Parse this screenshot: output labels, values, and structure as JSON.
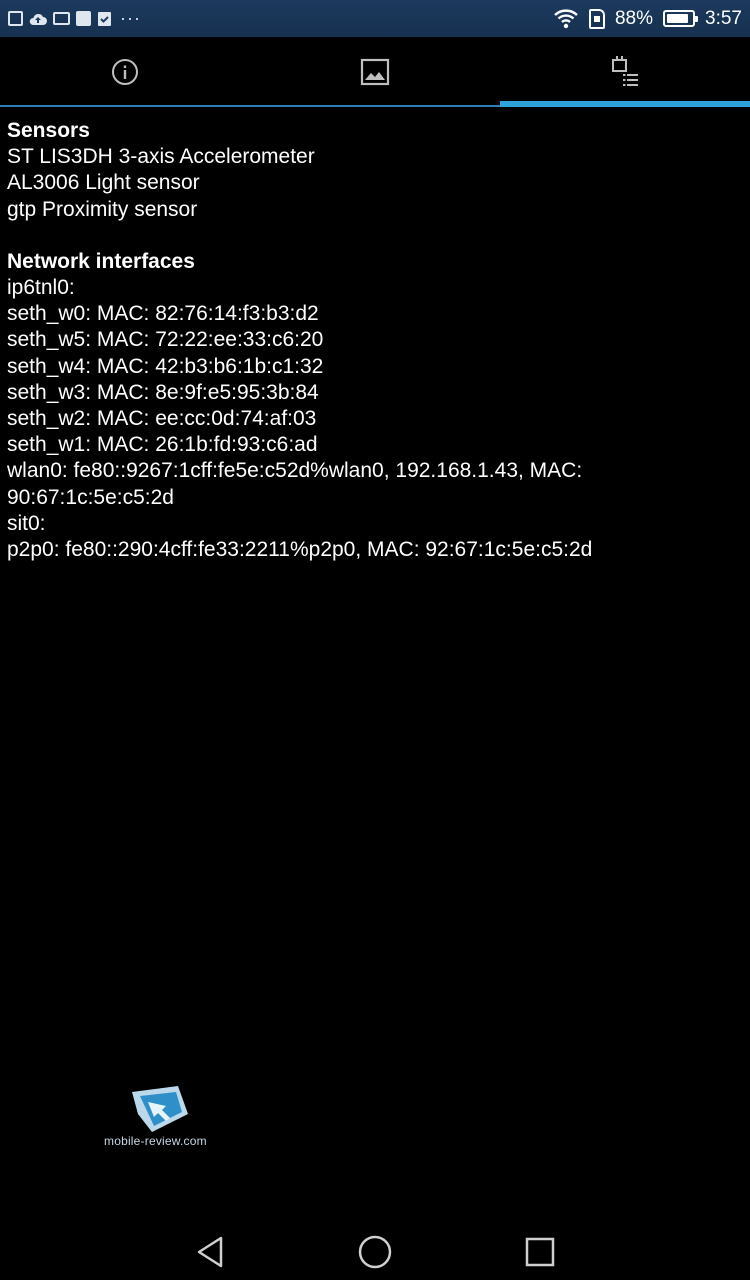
{
  "status_bar": {
    "left_icons": [
      "gallery-icon",
      "cloud-upload-icon",
      "keyboard-icon",
      "google-plus-icon",
      "clipboard-check-icon"
    ],
    "more": "···",
    "battery_percent": "88%",
    "battery_level": 0.88,
    "time": "3:57"
  },
  "tabs": [
    {
      "icon": "info-icon",
      "active": false
    },
    {
      "icon": "image-icon",
      "active": false
    },
    {
      "icon": "device-list-icon",
      "active": true
    }
  ],
  "sensors": {
    "heading": "Sensors",
    "items": [
      "ST LIS3DH 3-axis Accelerometer",
      "AL3006 Light sensor",
      "gtp Proximity sensor"
    ]
  },
  "network": {
    "heading": "Network interfaces",
    "items": [
      "ip6tnl0:",
      "seth_w0: MAC: 82:76:14:f3:b3:d2",
      "seth_w5: MAC: 72:22:ee:33:c6:20",
      "seth_w4: MAC: 42:b3:b6:1b:c1:32",
      "seth_w3: MAC: 8e:9f:e5:95:3b:84",
      "seth_w2: MAC: ee:cc:0d:74:af:03",
      "seth_w1: MAC: 26:1b:fd:93:c6:ad",
      "wlan0: fe80::9267:1cff:fe5e:c52d%wlan0, 192.168.1.43, MAC:",
      "90:67:1c:5e:c5:2d",
      "sit0:",
      "p2p0: fe80::290:4cff:fe33:2211%p2p0, MAC: 92:67:1c:5e:c5:2d"
    ]
  },
  "watermark": {
    "text": "mobile-review.com"
  },
  "nav": [
    "back-icon",
    "home-icon",
    "recents-icon"
  ],
  "colors": {
    "accent": "#2ea3d8",
    "status_bar": "#1c3a5e",
    "background": "#000000"
  }
}
